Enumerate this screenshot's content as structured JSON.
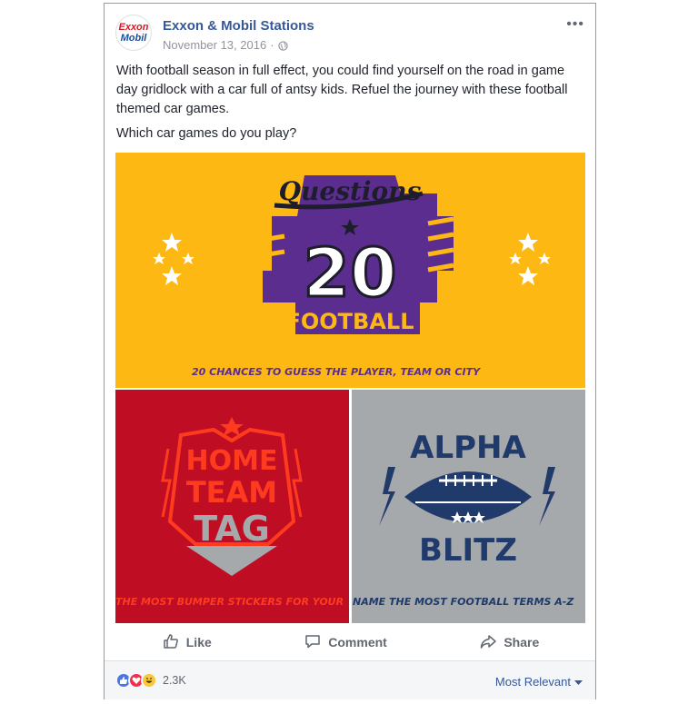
{
  "post": {
    "page_name": "Exxon & Mobil Stations",
    "avatar_line1": "Exxon",
    "avatar_line2": "Mobil",
    "date": "November 13, 2016",
    "date_separator": "·",
    "privacy_icon": "globe-icon",
    "more_label": "•••",
    "text": "With football season in full effect, you could find yourself on the road in game day gridlock with a car full of antsy kids. Refuel the journey with these football themed car games.",
    "question": "Which car games do you play?"
  },
  "images": {
    "top": {
      "title": "Questions",
      "number": "20",
      "subtitle": "FOOTBALL",
      "caption": "20 CHANCES TO GUESS THE PLAYER, TEAM OR CITY"
    },
    "left": {
      "line1": "HOME",
      "line2": "TEAM",
      "line3": "TAG",
      "caption": "THE MOST BUMPER STICKERS FOR YOUR"
    },
    "right": {
      "line1": "ALPHA",
      "line2": "BLITZ",
      "caption": "NAME THE MOST FOOTBALL TERMS A-Z"
    }
  },
  "actions": {
    "like": "Like",
    "comment": "Comment",
    "share": "Share"
  },
  "footer": {
    "reaction_count": "2.3K",
    "sort_label": "Most Relevant"
  },
  "colors": {
    "link_blue": "#365899",
    "gold": "#fdb813",
    "purple": "#5b2d8e",
    "red": "#bf0d24",
    "gray": "#a5a9ab",
    "navy": "#1f3a6b"
  }
}
